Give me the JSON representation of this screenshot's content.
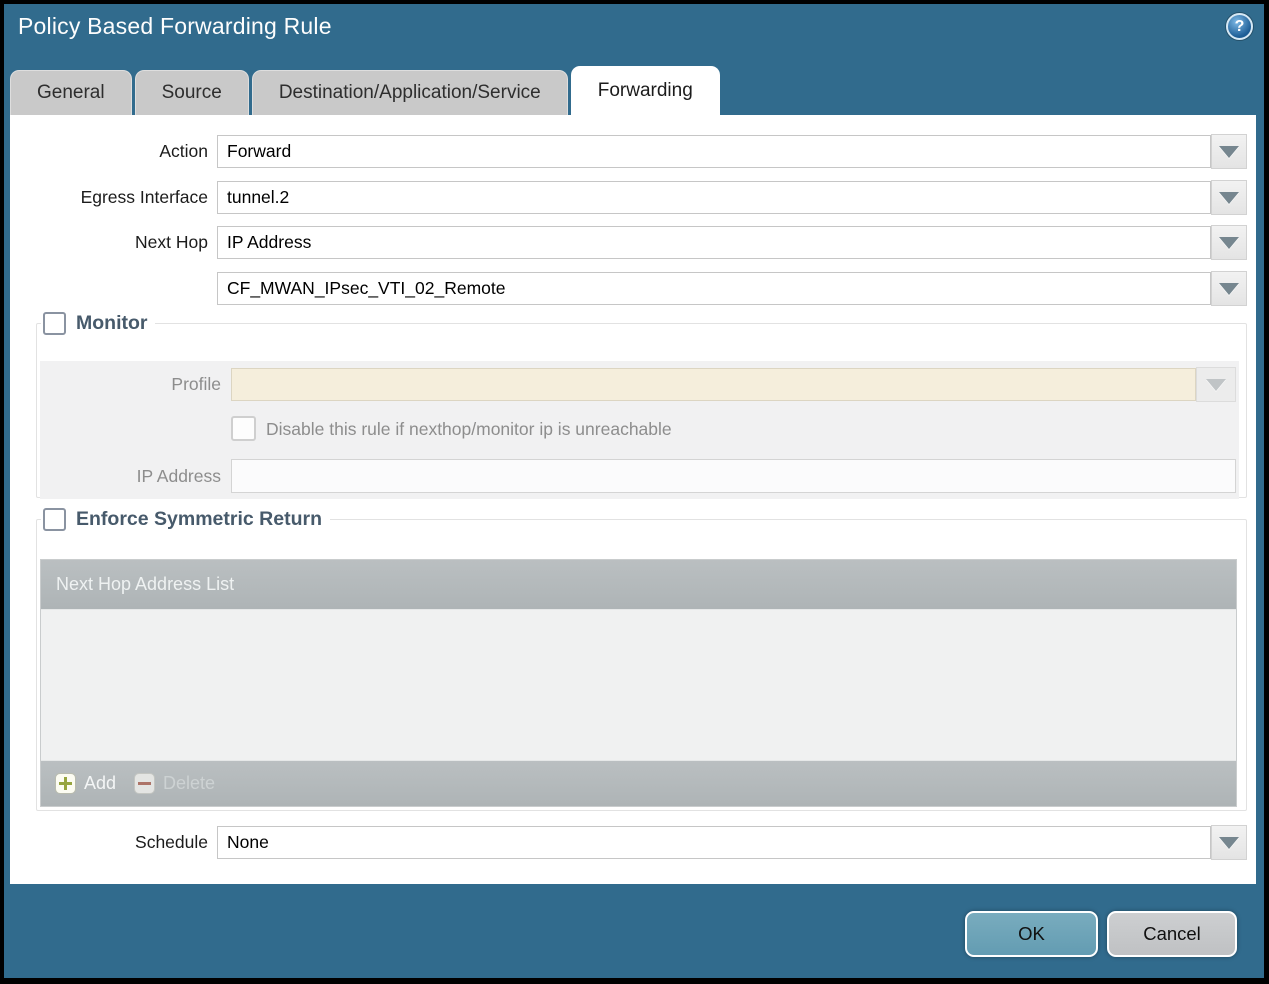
{
  "window": {
    "title": "Policy Based Forwarding Rule",
    "help_glyph": "?"
  },
  "tabs": [
    {
      "label": "General",
      "active": false
    },
    {
      "label": "Source",
      "active": false
    },
    {
      "label": "Destination/Application/Service",
      "active": false
    },
    {
      "label": "Forwarding",
      "active": true
    }
  ],
  "form": {
    "action": {
      "label": "Action",
      "value": "Forward"
    },
    "egress_interface": {
      "label": "Egress Interface",
      "value": "tunnel.2"
    },
    "next_hop": {
      "label": "Next Hop",
      "value": "IP Address"
    },
    "next_hop_address": {
      "value": "CF_MWAN_IPsec_VTI_02_Remote"
    },
    "schedule": {
      "label": "Schedule",
      "value": "None"
    }
  },
  "monitor_section": {
    "title": "Monitor",
    "checkbox_checked": false,
    "profile": {
      "label": "Profile",
      "value": ""
    },
    "disable_rule": {
      "label": "Disable this rule if nexthop/monitor ip is unreachable",
      "checked": false
    },
    "ip_address": {
      "label": "IP Address",
      "value": ""
    }
  },
  "symmetric_return_section": {
    "title": "Enforce Symmetric Return",
    "checkbox_checked": false,
    "list": {
      "header": "Next Hop Address List",
      "rows": [],
      "add_label": "Add",
      "delete_label": "Delete"
    }
  },
  "footer": {
    "ok_label": "OK",
    "cancel_label": "Cancel"
  },
  "colors": {
    "dialog_teal": "#316b8d",
    "ok_button": "#6ca4b9",
    "cancel_button": "#c6c8ca",
    "table_header_gray": "#b5babc",
    "table_body_gray": "#f0f1f1",
    "disabled_field_beige": "#f5eedc",
    "add_icon_green": "#97a53f",
    "delete_icon_red": "#ad7468"
  }
}
